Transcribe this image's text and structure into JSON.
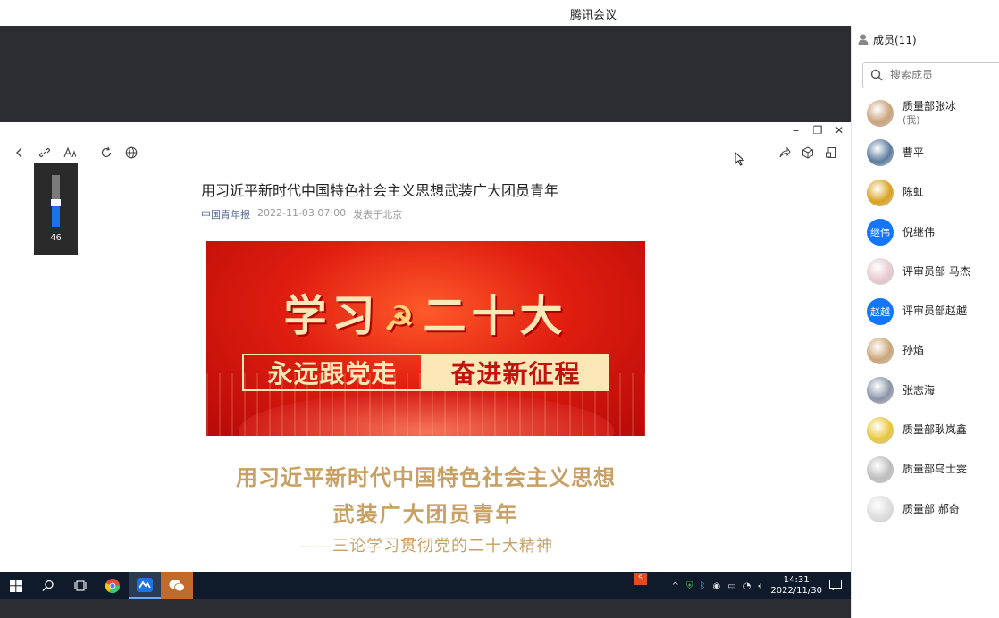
{
  "window": {
    "title": "腾讯会议"
  },
  "article": {
    "title": "用习近平新时代中国特色社会主义思想武装广大团员青年",
    "source": "中国青年报",
    "datetime": "2022-11-03 07:00",
    "location": "发表于北京",
    "banner_main": "学习",
    "banner_main2": "二十大",
    "banner_left": "永远跟党走",
    "banner_right": "奋进新征程",
    "subhead_line1": "用习近平新时代中国特色社会主义思想",
    "subhead_line2": "武装广大团员青年",
    "subhead_line3": "——三论学习贯彻党的二十大精神"
  },
  "zoom": {
    "value": "46",
    "level_percent": 46
  },
  "taskbar": {
    "time": "14:31",
    "date": "2022/11/30"
  },
  "members": {
    "header": "成员(11)",
    "search_placeholder": "搜索成员",
    "list": [
      {
        "name": "质量部张冰",
        "sub": "(我)",
        "avatar": "dog-photo",
        "color": "#c9a27a"
      },
      {
        "name": "曹平",
        "sub": "",
        "avatar": "landscape-photo",
        "color": "#5c7c9e"
      },
      {
        "name": "陈虹",
        "sub": "",
        "avatar": "flower-field-photo",
        "color": "#d9a21f"
      },
      {
        "name": "倪继伟",
        "sub": "",
        "avatar_text": "继伟"
      },
      {
        "name": "评审员部 马杰",
        "sub": "",
        "avatar": "flower-photo",
        "color": "#e7c9cf"
      },
      {
        "name": "评审员部赵越",
        "sub": "",
        "avatar_text": "赵越"
      },
      {
        "name": "孙焰",
        "sub": "",
        "avatar": "cat-photo",
        "color": "#caa577"
      },
      {
        "name": "张志海",
        "sub": "",
        "avatar": "people-photo",
        "color": "#8a94a8"
      },
      {
        "name": "质量部耿岚鑫",
        "sub": "",
        "avatar": "minion-photo",
        "color": "#e8c63a"
      },
      {
        "name": "质量部乌士雯",
        "sub": "",
        "avatar": "moon-photo",
        "color": "#bdbdbd"
      },
      {
        "name": "质量部 郝奇",
        "sub": "",
        "avatar": "astronaut-photo",
        "color": "#dddddd"
      }
    ]
  }
}
